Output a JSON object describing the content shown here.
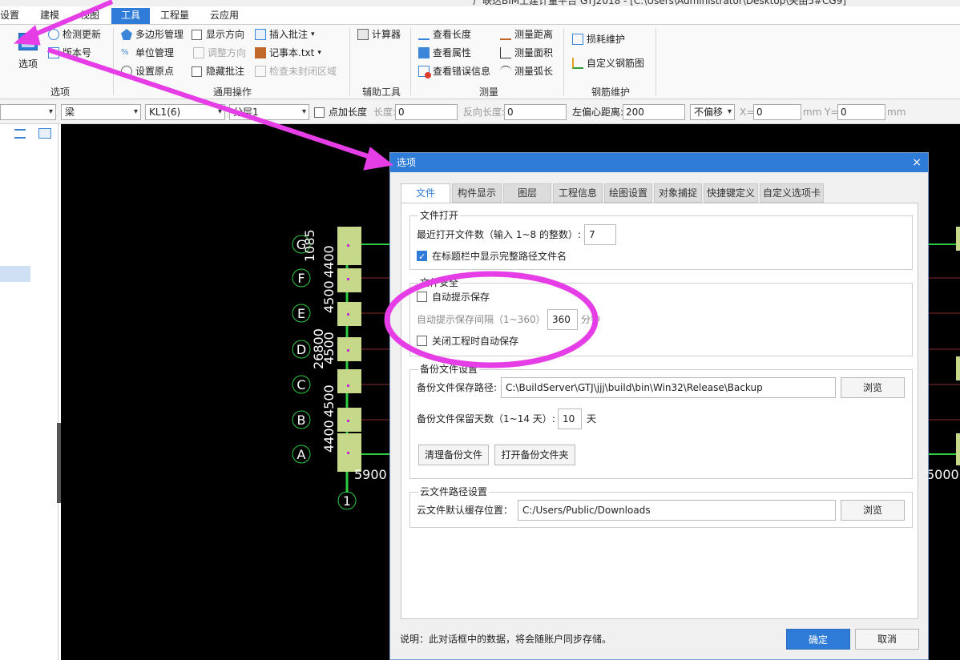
{
  "window": {
    "title": "广联达BIM土建计量平台 GTJ2018 - [C:\\Users\\Administrator\\Desktop\\关由5#CG9]"
  },
  "menu": [
    "设置",
    "建模",
    "视图",
    "工具",
    "工程量",
    "云应用"
  ],
  "ribbon": {
    "options_label": "选项",
    "check_update": "检测更新",
    "version": "版本号",
    "polygon_mgmt": "多边形管理",
    "unit_mgmt": "单位管理",
    "set_origin": "设置原点",
    "show_direction": "显示方向",
    "adjust_direction": "调整方向",
    "hide_annotation": "隐藏批注",
    "insert_annotation": "插入批注",
    "notepad": "记事本.txt",
    "check_unclosed": "检查未封闭区域",
    "calculator": "计算器",
    "view_length": "查看长度",
    "view_property": "查看属性",
    "view_errors": "查看错误信息",
    "measure_distance": "测量距离",
    "measure_area": "测量面积",
    "measure_arc": "测量弧长",
    "loss_maintain": "损耗维护",
    "custom_rebar": "自定义钢筋图",
    "groups": {
      "options": "选项",
      "general": "通用操作",
      "aux": "辅助工具",
      "measure": "测量",
      "rebar": "钢筋维护"
    }
  },
  "toolbar": {
    "type_select": "梁",
    "name_select": "KL1(6)",
    "layer_select": "分层1",
    "add_length": "点加长度",
    "length_label": "长度:",
    "length_value": "0",
    "reverse_length_label": "反向长度:",
    "reverse_length_value": "0",
    "left_offset_label": "左偏心距离:",
    "left_offset_value": "200",
    "offset_mode": "不偏移",
    "x_label": "X=",
    "x_value": "0",
    "y_label": "Y=",
    "y_value": "0",
    "unit": "mm"
  },
  "drawing": {
    "axes": [
      "G",
      "F",
      "E",
      "D",
      "C",
      "B",
      "A"
    ],
    "dims": [
      "4400",
      "4500",
      "4500",
      "4500",
      "4400"
    ],
    "top_dim": "1085",
    "total_dim": "26800",
    "bottom_dim": "5900",
    "right_dim": "5000",
    "col_axis": "1"
  },
  "dialog": {
    "title": "选项",
    "close": "×",
    "tabs": [
      "文件",
      "构件显示",
      "图层",
      "工程信息",
      "绘图设置",
      "对象捕捉",
      "快捷键定义",
      "自定义选项卡"
    ],
    "file_open": {
      "legend": "文件打开",
      "recent_label": "最近打开文件数（输入 1~8 的整数）:",
      "recent_value": "7",
      "show_full_path": "在标题栏中显示完整路径文件名",
      "show_full_path_checked": true
    },
    "file_security": {
      "legend": "文件安全",
      "auto_save_prompt": "自动提示保存",
      "interval_label": "自动提示保存间隔（1~360）",
      "interval_value": "360",
      "interval_unit": "分钟",
      "save_on_close": "关闭工程时自动保存"
    },
    "backup": {
      "legend": "备份文件设置",
      "path_label": "备份文件保存路径:",
      "path_value": "C:\\BuildServer\\GTJ\\jjj\\build\\bin\\Win32\\Release\\Backup",
      "browse": "浏览",
      "days_label": "备份文件保留天数（1~14 天）:",
      "days_value": "10",
      "days_unit": "天",
      "clear_button": "清理备份文件",
      "open_button": "打开备份文件夹"
    },
    "cloud": {
      "legend": "云文件路径设置",
      "cache_label": "云文件默认缓存位置：",
      "cache_value": "C:/Users/Public/Downloads",
      "browse": "浏览"
    },
    "note": "说明：此对话框中的数据，将会随账户同步存储。",
    "ok": "确定",
    "cancel": "取消"
  },
  "colors": {
    "accent": "#2f7bd8",
    "annotation": "#e63ee6",
    "grid": "#2ecc40"
  }
}
